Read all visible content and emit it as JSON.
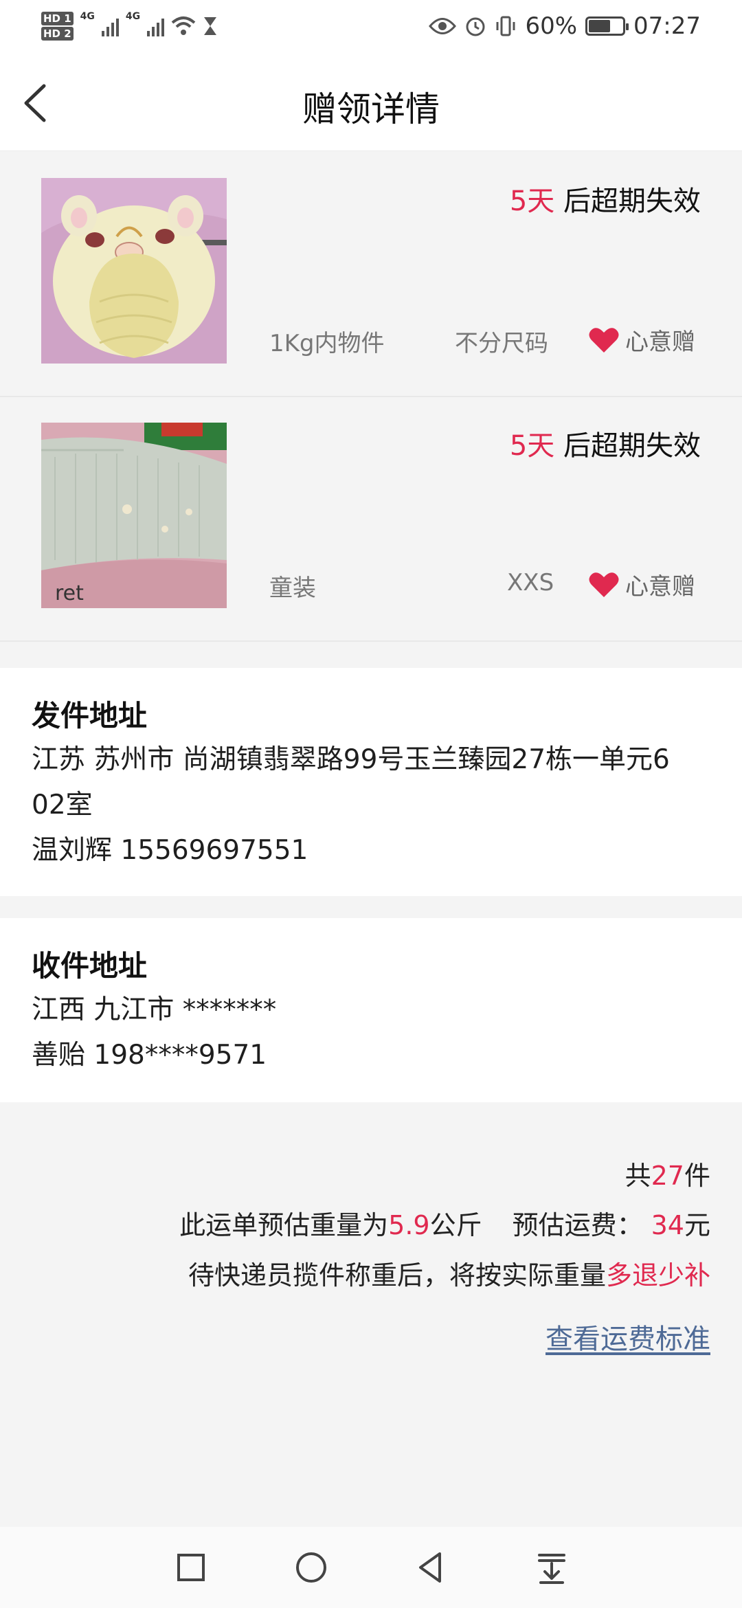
{
  "status_bar": {
    "sim1": "HD 1",
    "sim2": "HD 2",
    "network": "4G",
    "battery_percent": "60%",
    "battery_level": 0.6,
    "time": "07:27"
  },
  "header": {
    "title": "赠领详情",
    "back_icon": "back-arrow-icon"
  },
  "items": [
    {
      "days": "5天",
      "expire_suffix": " 后超期失效",
      "category": "1Kg内物件",
      "size": "不分尺码",
      "gift_label": "心意赠",
      "photo": "baby pillow"
    },
    {
      "days": "5天",
      "expire_suffix": " 后超期失效",
      "category": "童装",
      "size": "XXS",
      "gift_label": "心意赠",
      "photo": "children clothing"
    }
  ],
  "sender": {
    "heading": "发件地址",
    "address_line1": "江苏 苏州市 尚湖镇翡翠路99号玉兰臻园27栋一单元6",
    "address_line2": "02室",
    "contact": "温刘辉 15569697551"
  },
  "receiver": {
    "heading": "收件地址",
    "address": "江西 九江市 *******",
    "contact": "善贻 198****9571"
  },
  "summary": {
    "count_prefix": "共",
    "count": "27",
    "count_suffix": "件",
    "weight_prefix": "此运单预估重量为",
    "weight": "5.9",
    "weight_unit": "公斤",
    "fee_prefix": "预估运费：",
    "fee": "34",
    "fee_unit": "元",
    "note_prefix": "待快递员揽件称重后，将按实际重量",
    "note_highlight": "多退少补",
    "fee_standard_link": "查看运费标准"
  },
  "colors": {
    "accent_red": "#e0294f",
    "link_blue": "#4e6a96",
    "background": "#f4f4f4"
  },
  "nav_bar": [
    "square-icon",
    "circle-home-icon",
    "triangle-back-icon",
    "download-icon"
  ]
}
